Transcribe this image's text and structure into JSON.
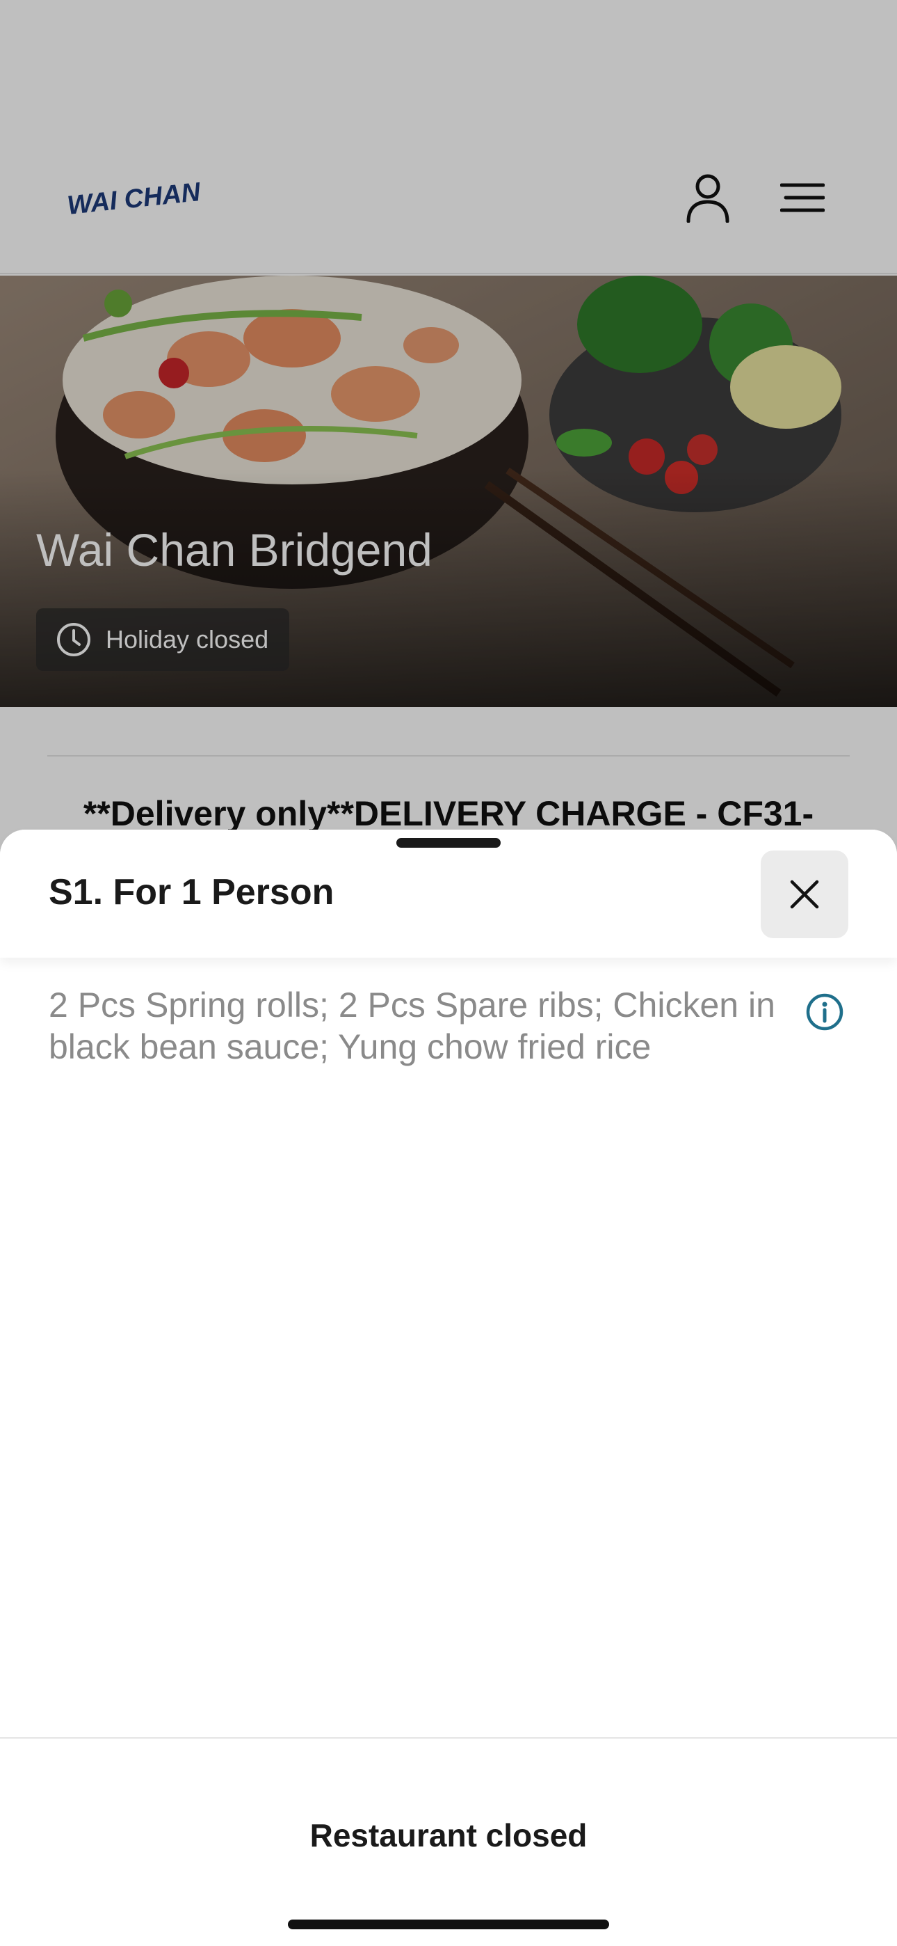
{
  "header": {
    "logo_text": "WAI CHAN",
    "icons": {
      "account": "user-icon",
      "menu": "hamburger-menu-icon"
    }
  },
  "hero": {
    "restaurant_name": "Wai Chan Bridgend",
    "status": "Holiday closed",
    "status_icon": "clock-icon"
  },
  "notice": "**Delivery only**DELIVERY CHARGE - CF31-",
  "sheet": {
    "title": "S1.  For 1 Person",
    "close_icon": "close-icon",
    "description": "2 Pcs Spring rolls; 2 Pcs Spare ribs; Chicken in black bean sauce; Yung chow fried rice",
    "info_icon": "info-icon",
    "footer_label": "Restaurant closed"
  },
  "colors": {
    "logo_blue": "#1c3a7a",
    "info_teal": "#1f6f8b",
    "overlay": "rgba(0,0,0,0.25)"
  }
}
